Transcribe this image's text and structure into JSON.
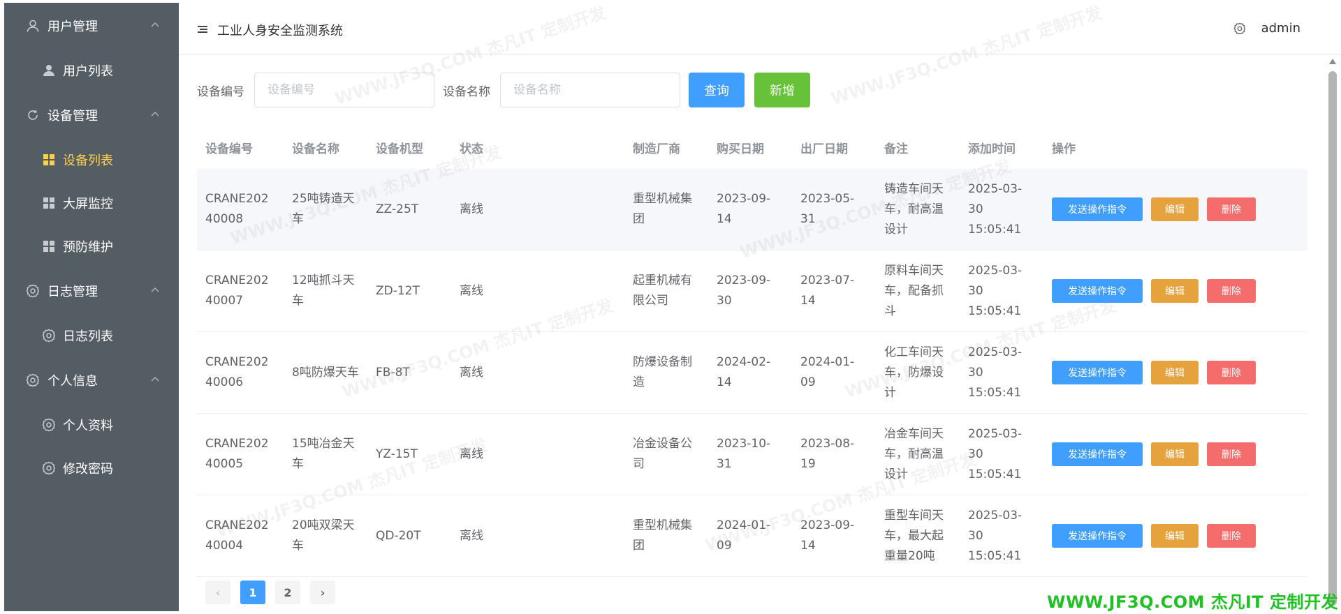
{
  "sidebar": {
    "groups": [
      {
        "label": "用户管理",
        "icon": "user-icon",
        "items": [
          {
            "label": "用户列表",
            "icon": "user-filled-icon"
          }
        ]
      },
      {
        "label": "设备管理",
        "icon": "refresh-icon",
        "items": [
          {
            "label": "设备列表",
            "icon": "grid-icon",
            "active": true
          },
          {
            "label": "大屏监控",
            "icon": "grid-icon"
          },
          {
            "label": "预防维护",
            "icon": "grid-icon"
          }
        ]
      },
      {
        "label": "日志管理",
        "icon": "gear-icon",
        "items": [
          {
            "label": "日志列表",
            "icon": "gear-icon"
          }
        ]
      },
      {
        "label": "个人信息",
        "icon": "gear-icon",
        "items": [
          {
            "label": "个人资料",
            "icon": "gear-icon"
          },
          {
            "label": "修改密码",
            "icon": "gear-icon"
          }
        ]
      }
    ]
  },
  "header": {
    "title": "工业人身安全监测系统",
    "user": "admin"
  },
  "search": {
    "code_label": "设备编号",
    "code_placeholder": "设备编号",
    "name_label": "设备名称",
    "name_placeholder": "设备名称",
    "query_button": "查询",
    "add_button": "新增"
  },
  "table": {
    "columns": [
      "设备编号",
      "设备名称",
      "设备机型",
      "状态",
      "制造厂商",
      "购买日期",
      "出厂日期",
      "备注",
      "添加时间",
      "操作"
    ],
    "rows": [
      {
        "code": "CRANE20240008",
        "name": "25吨铸造天车",
        "model": "ZZ-25T",
        "status": "离线",
        "maker": "重型机械集团",
        "buy_date": "2023-09-14",
        "factory_date": "2023-05-31",
        "remark": "铸造车间天车，耐高温设计",
        "added": "2025-03-30 15:05:41"
      },
      {
        "code": "CRANE20240007",
        "name": "12吨抓斗天车",
        "model": "ZD-12T",
        "status": "离线",
        "maker": "起重机械有限公司",
        "buy_date": "2023-09-30",
        "factory_date": "2023-07-14",
        "remark": "原料车间天车，配备抓斗",
        "added": "2025-03-30 15:05:41"
      },
      {
        "code": "CRANE20240006",
        "name": "8吨防爆天车",
        "model": "FB-8T",
        "status": "离线",
        "maker": "防爆设备制造",
        "buy_date": "2024-02-14",
        "factory_date": "2024-01-09",
        "remark": "化工车间天车，防爆设计",
        "added": "2025-03-30 15:05:41"
      },
      {
        "code": "CRANE20240005",
        "name": "15吨冶金天车",
        "model": "YZ-15T",
        "status": "离线",
        "maker": "冶金设备公司",
        "buy_date": "2023-10-31",
        "factory_date": "2023-08-19",
        "remark": "冶金车间天车，耐高温设计",
        "added": "2025-03-30 15:05:41"
      },
      {
        "code": "CRANE20240004",
        "name": "20吨双梁天车",
        "model": "QD-20T",
        "status": "离线",
        "maker": "重型机械集团",
        "buy_date": "2024-01-09",
        "factory_date": "2023-09-14",
        "remark": "重型车间天车，最大起重量20吨",
        "added": "2025-03-30 15:05:41"
      }
    ],
    "actions": {
      "send": "发送操作指令",
      "edit": "编辑",
      "delete": "删除"
    }
  },
  "pagination": {
    "prev": "‹",
    "pages": [
      "1",
      "2"
    ],
    "current": "1",
    "next": "›"
  },
  "watermark": {
    "banner": "WWW.JF3Q.COM 杰凡IT  定制开发",
    "text": "WWW.JF3Q.COM 杰凡IT  定制开发"
  },
  "colors": {
    "sidebar_bg": "#545c64",
    "active": "#ffd04b",
    "primary": "#409eff",
    "success": "#67c23a",
    "warning": "#e6a23c",
    "danger": "#f56c6c",
    "watermark_green": "#21c025"
  }
}
